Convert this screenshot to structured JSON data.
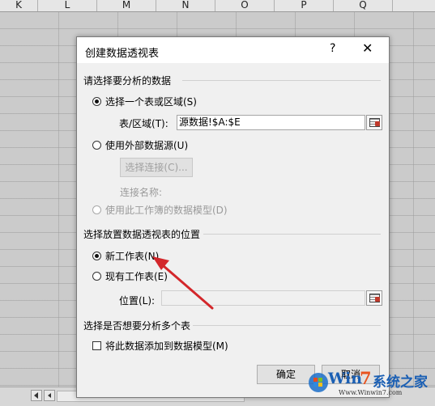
{
  "sheet": {
    "columns": [
      "K",
      "L",
      "M",
      "N",
      "O",
      "P",
      "Q"
    ]
  },
  "dialog": {
    "title": "创建数据透视表",
    "help": "?",
    "close": "✕",
    "section_data": "请选择要分析的数据",
    "radio_select_table": "选择一个表或区域(S)",
    "table_range_label": "表/区域(T):",
    "table_range_value": "源数据!$A:$E",
    "radio_external": "使用外部数据源(U)",
    "choose_connection": "选择连接(C)...",
    "connection_name_label": "连接名称:",
    "radio_data_model": "使用此工作簿的数据模型(D)",
    "section_location": "选择放置数据透视表的位置",
    "radio_new_sheet": "新工作表(N)",
    "radio_existing_sheet": "现有工作表(E)",
    "location_label": "位置(L):",
    "location_value": "",
    "section_multi": "选择是否想要分析多个表",
    "checkbox_add_model": "将此数据添加到数据模型(M)",
    "ok_button": "确定",
    "cancel_button": "取消"
  },
  "annotation": {
    "arrow_color": "#d3262a"
  },
  "watermark": {
    "text_win": "Win",
    "text_num": "7",
    "text_cn": "系统之家",
    "url": "Www.Winwin7.com"
  }
}
